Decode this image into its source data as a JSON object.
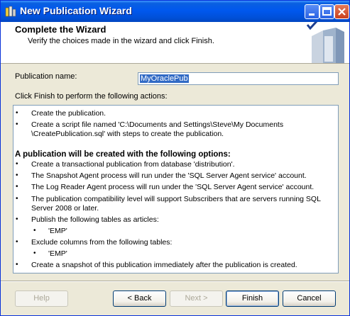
{
  "window": {
    "title": "New Publication Wizard"
  },
  "header": {
    "title": "Complete the Wizard",
    "subtitle": "Verify the choices made in the wizard and click Finish."
  },
  "publication": {
    "label": "Publication name:",
    "value": "MyOraclePub"
  },
  "actions": {
    "intro": "Click Finish to perform the following actions:",
    "lines": [
      "Create the publication.",
      "Create a script file named 'C:\\Documents and Settings\\Steve\\My Documents",
      "\\CreatePublication.sql' with steps to create the publication.",
      "A publication will be created with the following options:",
      "Create a transactional publication from database 'distribution'.",
      "The Snapshot Agent process will run under the 'SQL Server Agent service' account.",
      "The Log Reader Agent process will run under the 'SQL Server Agent service' account.",
      "The publication compatibility level will support Subscribers that are servers running SQL",
      "Server 2008 or later.",
      "Publish the following tables as articles:",
      "'EMP'",
      "Exclude columns from the following tables:",
      "'EMP'",
      "Create a snapshot of this publication immediately after the publication is created."
    ]
  },
  "buttons": {
    "help": "Help",
    "back": "< Back",
    "next": "Next >",
    "finish": "Finish",
    "cancel": "Cancel"
  },
  "colors": {
    "titlebar": "#0058ee",
    "selection": "#316ac5",
    "dialog": "#ece9d8"
  }
}
